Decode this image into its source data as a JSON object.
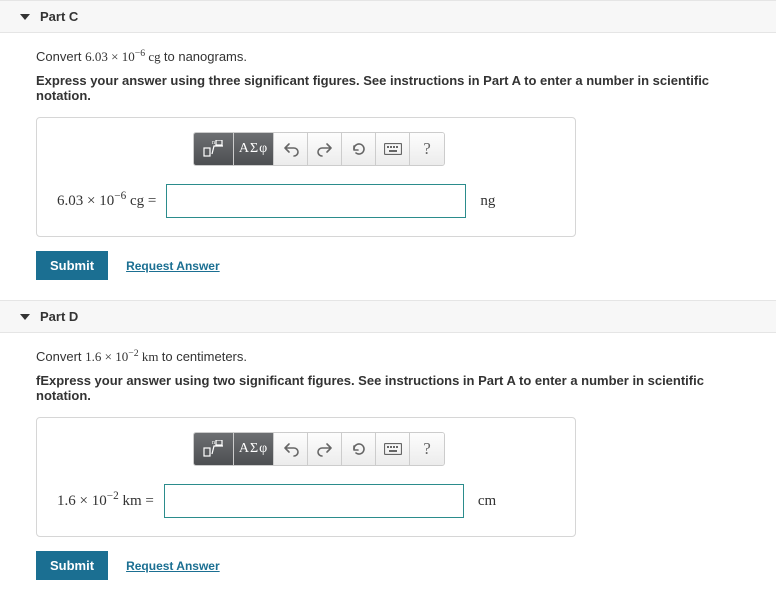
{
  "parts": [
    {
      "title": "Part C",
      "prompt_prefix": "Convert ",
      "value_base": "6.03",
      "value_exp": "−6",
      "value_unit": "cg",
      "prompt_suffix": " to nanograms.",
      "instruction": "Express your answer using three significant figures. See instructions in Part A to enter a number in scientific notation.",
      "lhs_base": "6.03",
      "lhs_exp": "−6",
      "lhs_unit": "cg",
      "rhs_unit": "ng",
      "submit": "Submit",
      "request": "Request Answer"
    },
    {
      "title": "Part D",
      "prompt_prefix": "Convert ",
      "value_base": "1.6",
      "value_exp": "−2",
      "value_unit": "km",
      "prompt_suffix": " to centimeters.",
      "instruction": "fExpress your answer using two significant figures. See instructions in Part A to enter a number in scientific notation.",
      "lhs_base": "1.6",
      "lhs_exp": "−2",
      "lhs_unit": "km",
      "rhs_unit": "cm",
      "submit": "Submit",
      "request": "Request Answer"
    }
  ],
  "toolbar": {
    "templates_label": "x√",
    "greek_label": "ΑΣφ"
  }
}
